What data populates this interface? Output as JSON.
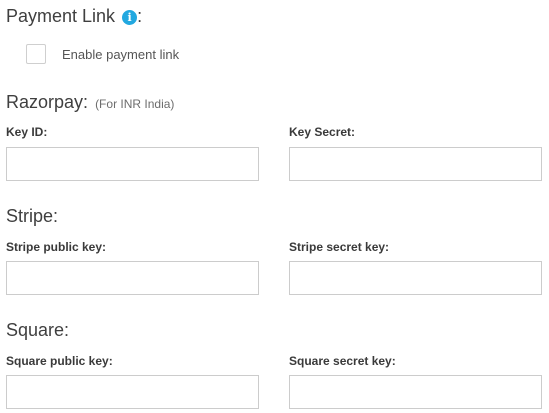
{
  "payment_link": {
    "title": "Payment Link",
    "colon": ":",
    "info_icon": "info-icon",
    "info_glyph": "i",
    "checkbox_label": "Enable payment link",
    "checked": false
  },
  "razorpay": {
    "title": "Razorpay:",
    "subtitle": "(For INR India)",
    "key_id_label": "Key ID:",
    "key_id_value": "",
    "key_secret_label": "Key Secret:",
    "key_secret_value": ""
  },
  "stripe": {
    "title": "Stripe:",
    "public_key_label": "Stripe public key:",
    "public_key_value": "",
    "secret_key_label": "Stripe secret key:",
    "secret_key_value": ""
  },
  "square": {
    "title": "Square:",
    "public_key_label": "Square public key:",
    "public_key_value": "",
    "secret_key_label": "Square secret key:",
    "secret_key_value": ""
  },
  "colors": {
    "info_icon": "#22a8e0",
    "input_border": "#cccccc"
  }
}
